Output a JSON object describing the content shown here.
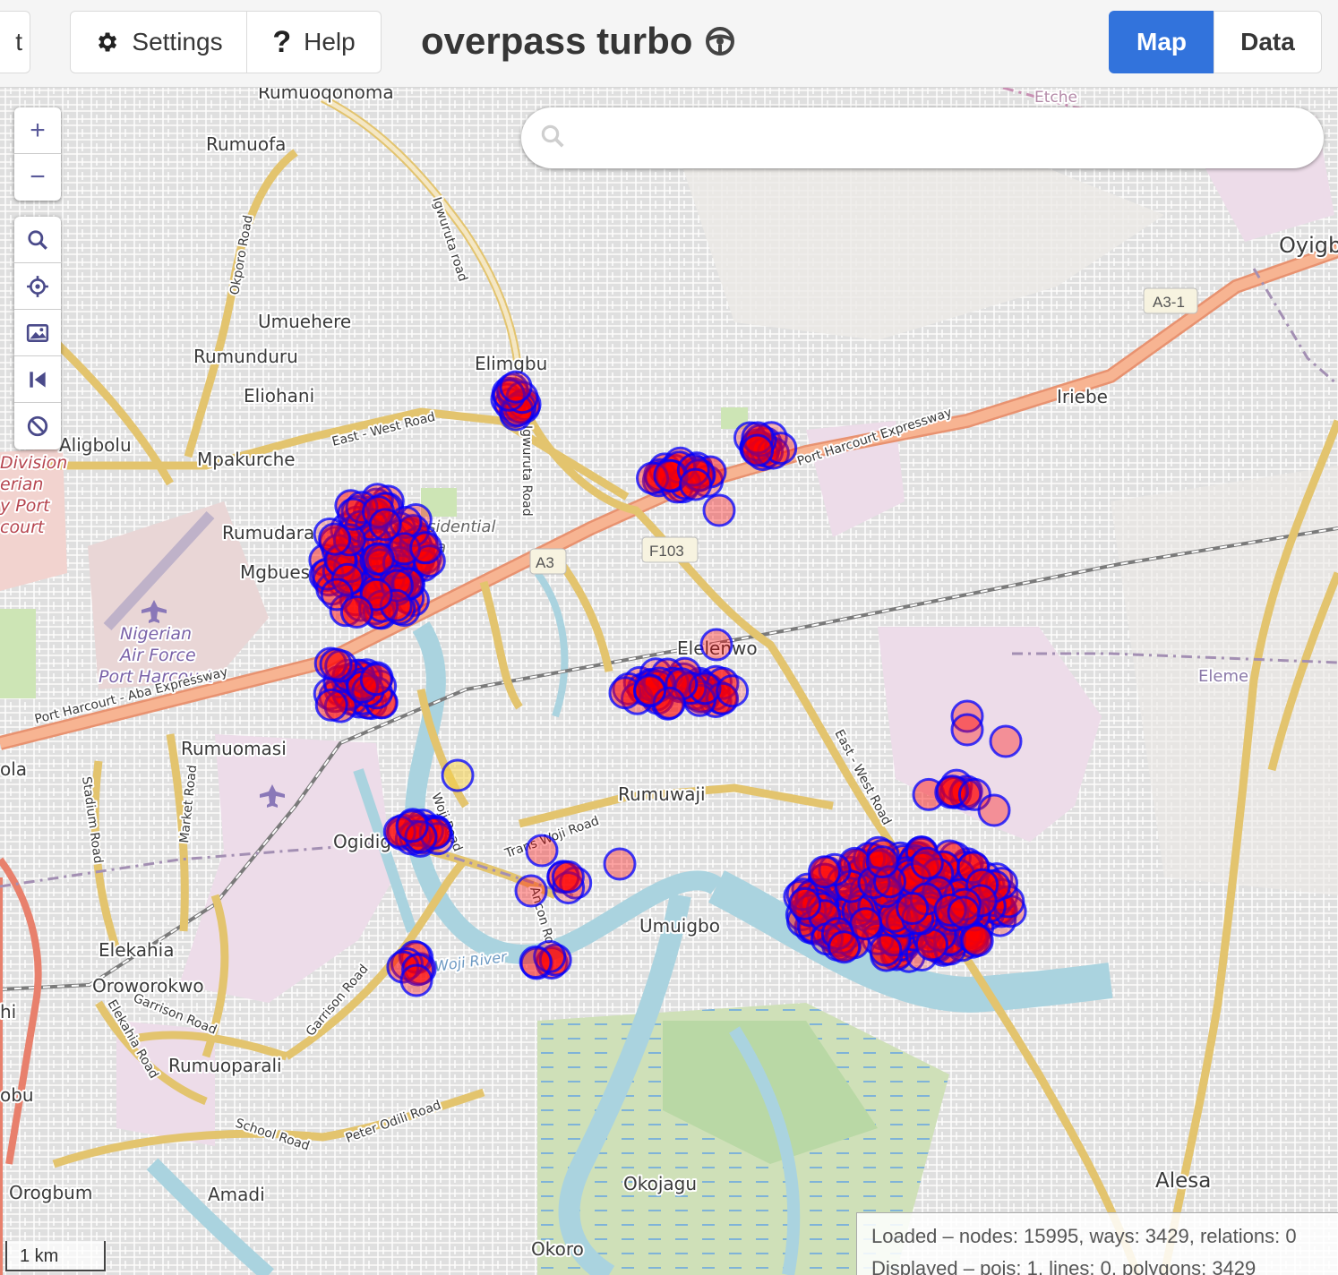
{
  "header": {
    "cut_button_label": "t",
    "settings_label": "Settings",
    "help_label": "Help",
    "app_title": "overpass turbo",
    "tabs": {
      "map": "Map",
      "data": "Data"
    },
    "active_tab": "Map",
    "accent_color": "#3273dc"
  },
  "map_controls": {
    "zoom_in": "+",
    "zoom_out": "−",
    "tools": [
      "search-icon",
      "crosshair-icon",
      "image-icon",
      "skip-back-icon",
      "no-entry-icon"
    ]
  },
  "search": {
    "placeholder": ""
  },
  "map": {
    "place_labels": [
      "Rumuoqonoma",
      "Rumuofa",
      "Umuehere",
      "Rumunduru",
      "Eliohani",
      "Aligbolu",
      "Mpakurche",
      "Rumudara",
      "Mgbues",
      "Elimgbu",
      "Iriebe",
      "Oyigb",
      "Eleme",
      "Elelenwo",
      "Rumuomasi",
      "Rumuwaji",
      "Ogidig",
      "Umuigbo",
      "Elekahia",
      "Oroworokwo",
      "Rumuoparali",
      "Orogbum",
      "Amadi",
      "Okojagu",
      "Okoro",
      "Alesa",
      "Etche",
      "ola",
      "obu",
      "hi"
    ],
    "area_labels": [
      "Nigerian",
      "Air Force",
      "Port Harcourt",
      "esidential",
      "ea",
      "Division",
      "erian",
      "y Port",
      "court"
    ],
    "road_labels": [
      "Igwuruta road",
      "Okporo Road",
      "East - West Road",
      "Port Harcourt Expressway",
      "Port Harcourt - Aba Expressway",
      "Igwuruta Road",
      "Trans Woji Road",
      "Woji Road",
      "Garrison Road",
      "Peter Odili Road",
      "School Road",
      "Elekahia Road",
      "Stadium Road",
      "Market Road",
      "Woji River",
      "Ancon Ro"
    ],
    "shields": [
      "A3-1",
      "A3",
      "F103"
    ],
    "marker_fill": "#ff0000",
    "marker_stroke": "#0000ff"
  },
  "scale": {
    "label": "1 km"
  },
  "stats": {
    "loaded": "Loaded – nodes: 15995, ways: 3429, relations: 0",
    "displayed": "Displayed – pois: 1, lines: 0, polygons: 3429"
  }
}
